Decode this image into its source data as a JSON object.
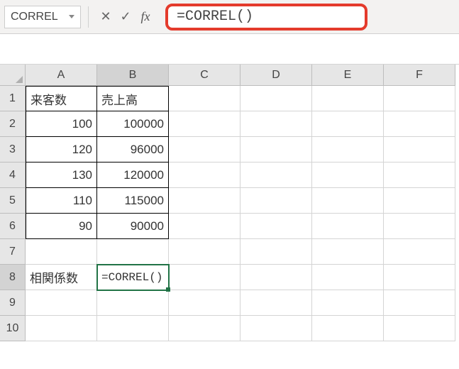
{
  "name_box": "CORREL",
  "formula_bar": "=CORREL()",
  "columns": [
    "A",
    "B",
    "C",
    "D",
    "E",
    "F"
  ],
  "rows": [
    "1",
    "2",
    "3",
    "4",
    "5",
    "6",
    "7",
    "8",
    "9",
    "10"
  ],
  "headers": {
    "A1": "来客数",
    "B1": "売上高"
  },
  "data": {
    "A2": "100",
    "B2": "100000",
    "A3": "120",
    "B3": "96000",
    "A4": "130",
    "B4": "120000",
    "A5": "110",
    "B5": "115000",
    "A6": "90",
    "B6": "90000"
  },
  "label_A8": "相関係数",
  "editing_B8": "=CORREL()",
  "icons": {
    "cancel": "✕",
    "confirm": "✓",
    "fx": "fx"
  }
}
